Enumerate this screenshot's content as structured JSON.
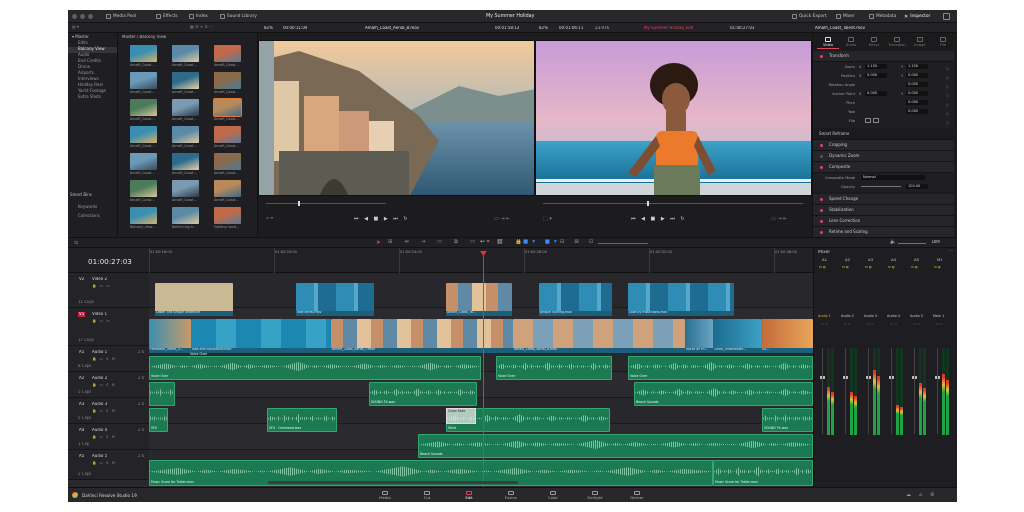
{
  "topbar": {
    "media_pool": "Media Pool",
    "effects": "Effects",
    "index": "Index",
    "sound_library": "Sound Library",
    "project_title": "My Summer Holiday",
    "quick_export": "Quick Export",
    "mixer": "Mixer",
    "metadata": "Metadata",
    "inspector": "Inspector"
  },
  "subbar": {
    "zoom_left": "82%",
    "tc_left": "00:00:11:09",
    "source_clip": "Amalfi_Coast_Aerial_8.mov",
    "tc_src": "00:01:58:12",
    "zoom_right": "82%",
    "tc_duration": "00:01:06:11",
    "fps": "23.976",
    "timeline_name": "My Summer Holiday Edit",
    "tc_timeline": "01:00:27:03",
    "inspector_clip": "Amalfi_Coast_Talent.mov"
  },
  "bins": {
    "master": "Master",
    "items": [
      "Edits",
      "Balcony View",
      "Audio",
      "End Credits",
      "Drone",
      "Airports",
      "Interviews",
      "Holiday Reel",
      "Yacht Footage",
      "Extra Shots"
    ],
    "smart_bins": "Smart Bins",
    "smart_items": [
      "Keywords",
      "Collections"
    ],
    "path": "Master / Balcony View"
  },
  "media": {
    "thumbs": [
      "Amalfi_Coast...",
      "Amalfi_Coast...",
      "Amalfi_Coast...",
      "Amalfi_Coast...",
      "Amalfi_Coast...",
      "Amalfi_Coast...",
      "Amalfi_Coast...",
      "Amalfi_Coast...",
      "Amalfi_Coast...",
      "Amalfi_Coast...",
      "Amalfi_Coast...",
      "Amalfi_Coast...",
      "Amalfi_Coast...",
      "Amalfi_Coast...",
      "Amalfi_Coast...",
      "Amalfi_Coast...",
      "Amalfi_Coast...",
      "Amalfi_Coast...",
      "Balcony_view...",
      "Behind big tr...",
      "Holding hand..."
    ]
  },
  "timeline": {
    "timecode": "01:00:27:03",
    "ruler": [
      "01:00:16:00",
      "01:00:20:00",
      "01:00:24:00",
      "01:00:28:00",
      "01:00:32:00",
      "01:00:36:00"
    ],
    "tracks": [
      {
        "id": "V2",
        "name": "Video 2",
        "clips": "11 Clips"
      },
      {
        "id": "V1",
        "name": "Video 1",
        "clips": "17 Clips"
      },
      {
        "id": "A1",
        "name": "Audio 1",
        "clips": "8 Clips",
        "ch": "2.0"
      },
      {
        "id": "A2",
        "name": "Audio 2",
        "clips": "5 Clips",
        "ch": "2.0"
      },
      {
        "id": "A3",
        "name": "Audio 3",
        "clips": "5 Clips",
        "ch": "2.0"
      },
      {
        "id": "A4",
        "name": "Audio 4",
        "clips": "1 Clip",
        "ch": "2.0"
      },
      {
        "id": "A5",
        "name": "Audio 5",
        "clips": "2 Clips",
        "ch": "2.0"
      }
    ],
    "clips": {
      "v2": [
        "Lower 3rd Simple Underline",
        "lake aerial.mov",
        "Amalfi_Coast_Ta...",
        "people running.mov",
        "Lake by mountains.mov"
      ],
      "v1": [
        "Feedback_Talent_3...",
        "lake and mountains.mov",
        "Amalfi_Coast_Aerial_7.mov",
        "Amalfi_Coast_Aerial_8.mov",
        "Horse on th...",
        "Turtle_Underwater...",
        "Su..."
      ],
      "a1": [
        "Voice Over",
        "Voice Over",
        "Voice Over",
        "Voice Over"
      ],
      "a2": [
        "SOUND FX.wav",
        "Beach Sounds"
      ],
      "a3": [
        "SFX",
        "SFX - Overhead.wav",
        "Cross Fade",
        "Wind",
        "SOUND FX.wav"
      ],
      "a4": [
        "Beach Sounds"
      ],
      "a5": [
        "Music Score for Trailer.mov",
        "Music Score for Trailer.mov"
      ]
    }
  },
  "inspector": {
    "tabs": [
      "Video",
      "Audio",
      "Effect",
      "Transition",
      "Image",
      "File"
    ],
    "transform": "Transform",
    "zoom": {
      "label": "Zoom",
      "x": "1.150",
      "y": "1.150"
    },
    "position": {
      "label": "Position",
      "x": "0.000",
      "y": "0.000"
    },
    "rotation": {
      "label": "Rotation Angle",
      "v": "0.000"
    },
    "anchor": {
      "label": "Anchor Point",
      "x": "0.000",
      "y": "0.000"
    },
    "pitch": {
      "label": "Pitch",
      "v": "0.000"
    },
    "yaw": {
      "label": "Yaw",
      "v": "0.000"
    },
    "flip": {
      "label": "Flip"
    },
    "sections": [
      "Smart Reframe",
      "Cropping",
      "Dynamic Zoom",
      "Composite",
      "Speed Change",
      "Stabilization",
      "Lens Correction",
      "Retime and Scaling"
    ],
    "composite_mode": {
      "label": "Composite Mode",
      "v": "Normal"
    },
    "opacity": {
      "label": "Opacity",
      "v": "100.00"
    }
  },
  "mixer": {
    "title": "Mixer",
    "strips": [
      "A1",
      "A2",
      "A3",
      "A4",
      "A5",
      "M1"
    ],
    "channels": [
      "Audio 1",
      "Audio 2",
      "Audio 3",
      "Audio 4",
      "Audio 5",
      "Main 1"
    ],
    "levels": [
      0.55,
      0.5,
      0.75,
      0.35,
      0.6,
      0.7
    ],
    "dim": "DIM"
  },
  "bottombar": {
    "brand": "DaVinci Resolve Studio 19",
    "pages": [
      "Media",
      "Cut",
      "Edit",
      "Fusion",
      "Color",
      "Fairlight",
      "Deliver"
    ]
  },
  "colors": {
    "accent_red": "#e0435d",
    "video_clip": "#1b5f7c",
    "audio_clip": "#1c7a52",
    "playhead": "#e0333c"
  }
}
